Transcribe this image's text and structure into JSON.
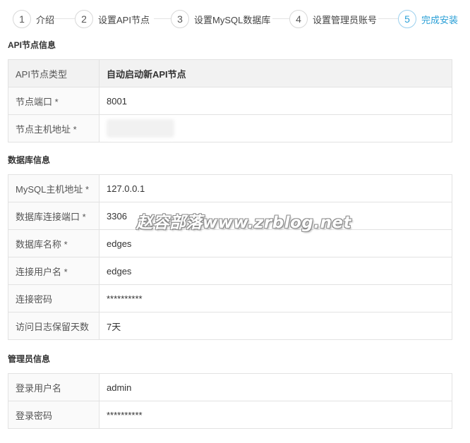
{
  "steps": [
    {
      "num": "1",
      "label": "介绍"
    },
    {
      "num": "2",
      "label": "设置API节点"
    },
    {
      "num": "3",
      "label": "设置MySQL数据库"
    },
    {
      "num": "4",
      "label": "设置管理员账号"
    },
    {
      "num": "5",
      "label": "完成安装"
    }
  ],
  "active_step": 5,
  "accent_color": "#2a9fd6",
  "api_section": {
    "title": "API节点信息",
    "rows": [
      {
        "label": "API节点类型",
        "value": "自动启动新API节点"
      },
      {
        "label": "节点端口 *",
        "value": "8001"
      },
      {
        "label": "节点主机地址 *",
        "value": ""
      }
    ]
  },
  "db_section": {
    "title": "数据库信息",
    "rows": [
      {
        "label": "MySQL主机地址 *",
        "value": "127.0.0.1"
      },
      {
        "label": "数据库连接端口 *",
        "value": "3306"
      },
      {
        "label": "数据库名称 *",
        "value": "edges"
      },
      {
        "label": "连接用户名 *",
        "value": "edges"
      },
      {
        "label": "连接密码",
        "value": "**********"
      },
      {
        "label": "访问日志保留天数",
        "value": "7天"
      }
    ]
  },
  "admin_section": {
    "title": "管理员信息",
    "rows": [
      {
        "label": "登录用户名",
        "value": "admin"
      },
      {
        "label": "登录密码",
        "value": "**********"
      }
    ]
  },
  "watermark": "赵容部落www.zrblog.net"
}
